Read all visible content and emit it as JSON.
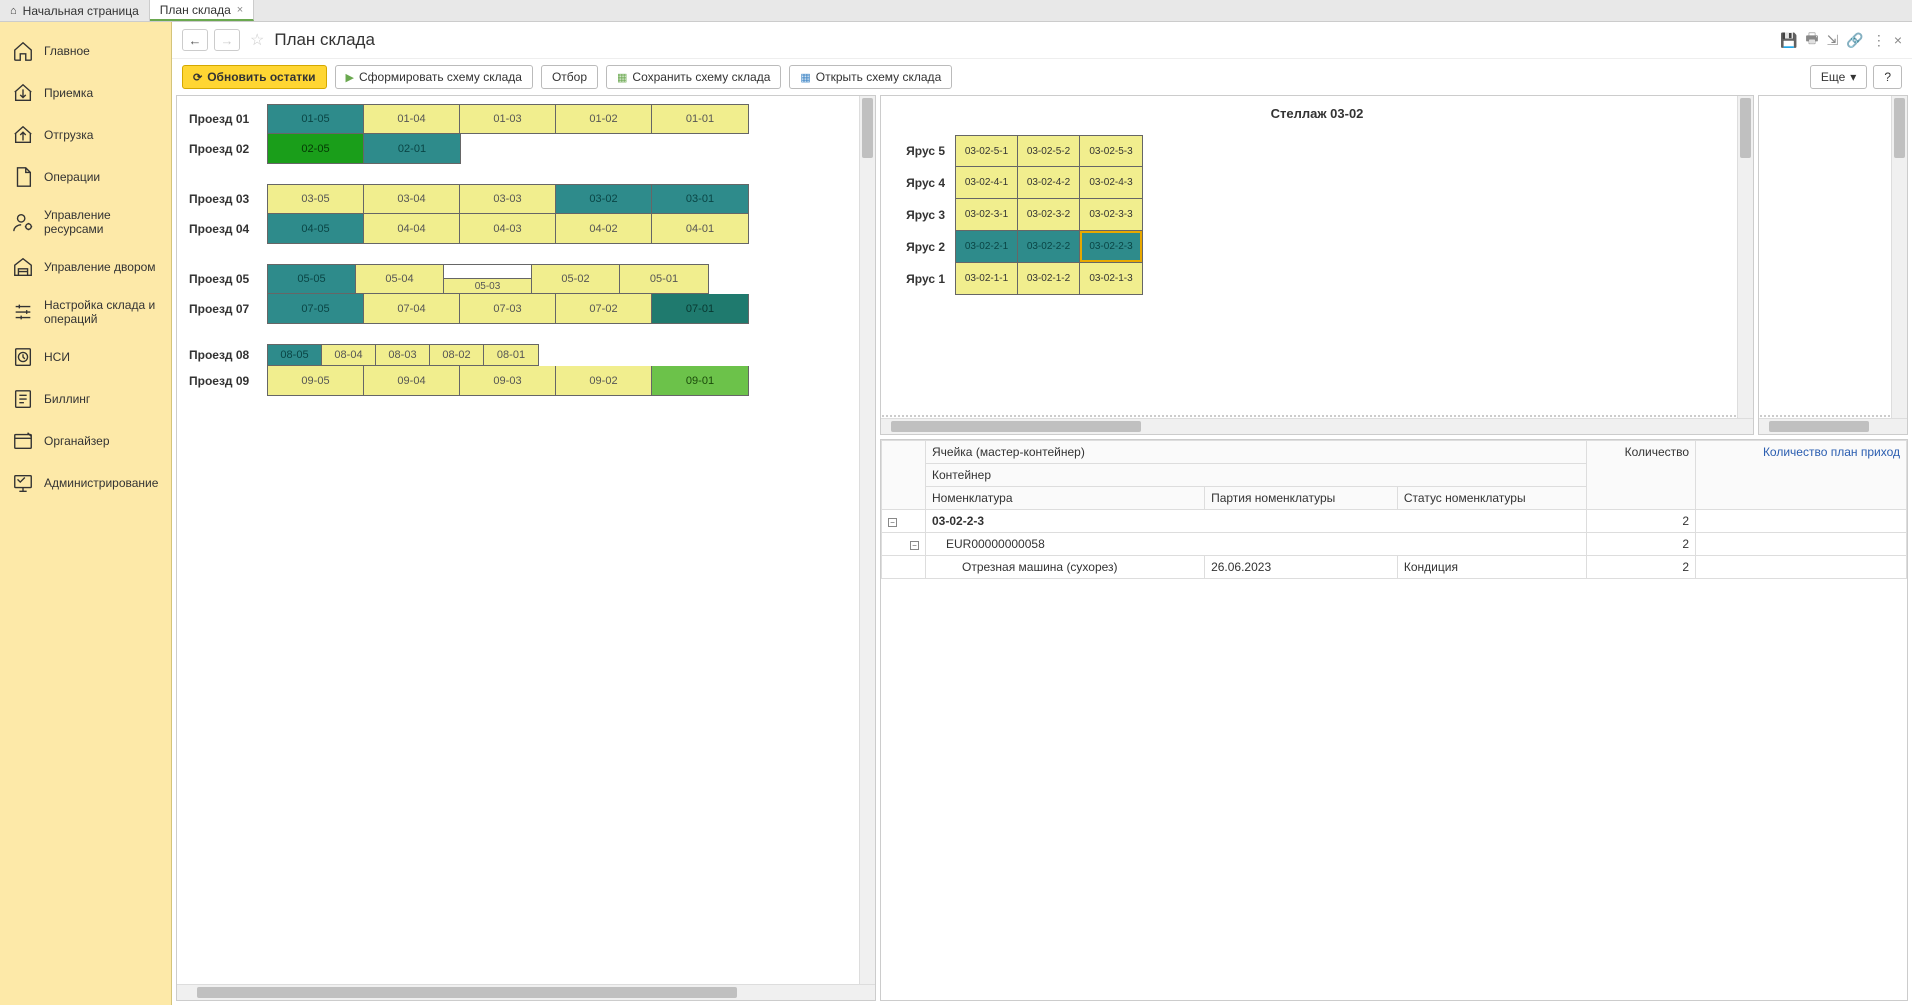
{
  "tabs": {
    "home": "Начальная страница",
    "plan": "План склада"
  },
  "sidebar": {
    "items": [
      {
        "label": "Главное"
      },
      {
        "label": "Приемка"
      },
      {
        "label": "Отгрузка"
      },
      {
        "label": "Операции"
      },
      {
        "label": "Управление ресурсами"
      },
      {
        "label": "Управление двором"
      },
      {
        "label": "Настройка склада и операций"
      },
      {
        "label": "НСИ"
      },
      {
        "label": "Биллинг"
      },
      {
        "label": "Органайзер"
      },
      {
        "label": "Администрирование"
      }
    ]
  },
  "header": {
    "title": "План склада"
  },
  "toolbar": {
    "refresh": "Обновить остатки",
    "generate": "Сформировать схему склада",
    "filter": "Отбор",
    "save": "Сохранить схему склада",
    "open": "Открыть схему склада",
    "more": "Еще",
    "help": "?"
  },
  "warehouse": {
    "groups": [
      {
        "rows": [
          {
            "label": "Проезд 01",
            "cells": [
              {
                "code": "01-05",
                "color": "teal"
              },
              {
                "code": "01-04",
                "color": "yellow"
              },
              {
                "code": "01-03",
                "color": "yellow"
              },
              {
                "code": "01-02",
                "color": "yellow"
              },
              {
                "code": "01-01",
                "color": "yellow"
              }
            ]
          },
          {
            "label": "Проезд 02",
            "cells": [
              {
                "code": "02-05",
                "color": "green"
              },
              {
                "code": "02-01",
                "color": "teal"
              }
            ]
          }
        ]
      },
      {
        "rows": [
          {
            "label": "Проезд 03",
            "cells": [
              {
                "code": "03-05",
                "color": "yellow"
              },
              {
                "code": "03-04",
                "color": "yellow"
              },
              {
                "code": "03-03",
                "color": "yellow"
              },
              {
                "code": "03-02",
                "color": "teal"
              },
              {
                "code": "03-01",
                "color": "teal"
              }
            ]
          },
          {
            "label": "Проезд 04",
            "cells": [
              {
                "code": "04-05",
                "color": "teal"
              },
              {
                "code": "04-04",
                "color": "yellow"
              },
              {
                "code": "04-03",
                "color": "yellow"
              },
              {
                "code": "04-02",
                "color": "yellow"
              },
              {
                "code": "04-01",
                "color": "yellow"
              }
            ]
          }
        ]
      },
      {
        "rows": [
          {
            "label": "Проезд 05",
            "split": true,
            "cells": [
              {
                "code": "05-05",
                "color": "teal"
              },
              {
                "code": "05-04",
                "color": "yellow"
              },
              {
                "top": {
                  "code": "",
                  "color": "white"
                },
                "bottom": {
                  "code": "05-03",
                  "color": "yellow"
                }
              },
              {
                "code": "05-02",
                "color": "yellow"
              },
              {
                "code": "05-01",
                "color": "yellow"
              }
            ],
            "narrow": true
          },
          {
            "label": "Проезд 07",
            "cells": [
              {
                "code": "07-05",
                "color": "teal"
              },
              {
                "code": "07-04",
                "color": "yellow"
              },
              {
                "code": "07-03",
                "color": "yellow"
              },
              {
                "code": "07-02",
                "color": "yellow"
              },
              {
                "code": "07-01",
                "color": "teal-dark"
              }
            ]
          }
        ]
      },
      {
        "rows": [
          {
            "label": "Проезд 08",
            "small": true,
            "cells": [
              {
                "code": "08-05",
                "color": "teal"
              },
              {
                "code": "08-04",
                "color": "yellow"
              },
              {
                "code": "08-03",
                "color": "yellow"
              },
              {
                "code": "08-02",
                "color": "yellow"
              },
              {
                "code": "08-01",
                "color": "yellow"
              }
            ]
          },
          {
            "label": "Проезд 09",
            "cells": [
              {
                "code": "09-05",
                "color": "yellow"
              },
              {
                "code": "09-04",
                "color": "yellow"
              },
              {
                "code": "09-03",
                "color": "yellow"
              },
              {
                "code": "09-02",
                "color": "yellow"
              },
              {
                "code": "09-01",
                "color": "bright-green"
              }
            ]
          }
        ]
      }
    ]
  },
  "rack": {
    "title": "Стеллаж 03-02",
    "tiers": [
      {
        "label": "Ярус 5",
        "cells": [
          {
            "code": "03-02-5-1"
          },
          {
            "code": "03-02-5-2"
          },
          {
            "code": "03-02-5-3"
          }
        ]
      },
      {
        "label": "Ярус 4",
        "cells": [
          {
            "code": "03-02-4-1"
          },
          {
            "code": "03-02-4-2"
          },
          {
            "code": "03-02-4-3"
          }
        ]
      },
      {
        "label": "Ярус 3",
        "cells": [
          {
            "code": "03-02-3-1"
          },
          {
            "code": "03-02-3-2"
          },
          {
            "code": "03-02-3-3"
          }
        ]
      },
      {
        "label": "Ярус 2",
        "cells": [
          {
            "code": "03-02-2-1",
            "color": "teal"
          },
          {
            "code": "03-02-2-2",
            "color": "teal"
          },
          {
            "code": "03-02-2-3",
            "color": "teal",
            "selected": true
          }
        ]
      },
      {
        "label": "Ярус 1",
        "cells": [
          {
            "code": "03-02-1-1"
          },
          {
            "code": "03-02-1-2"
          },
          {
            "code": "03-02-1-3"
          }
        ]
      }
    ]
  },
  "detail": {
    "headers": {
      "cell": "Ячейка (мастер-контейнер)",
      "qty": "Количество",
      "qty_plan": "Количество план приход",
      "container": "Контейнер",
      "nomenclature": "Номенклатура",
      "batch": "Партия номенклатуры",
      "status": "Статус номенклатуры"
    },
    "rows": {
      "cell_code": "03-02-2-3",
      "cell_qty": "2",
      "container": "EUR00000000058",
      "container_qty": "2",
      "item_name": "Отрезная машина (сухорез)",
      "item_batch": "26.06.2023",
      "item_status": "Кондиция",
      "item_qty": "2"
    }
  }
}
